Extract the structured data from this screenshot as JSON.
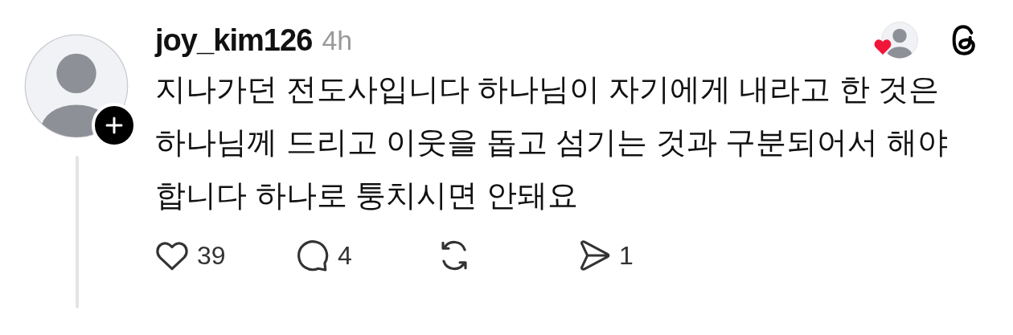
{
  "post": {
    "username": "joy_kim126",
    "time": "4h",
    "body": "지나가던 전도사입니다 하나님이 자기에게 내라고 한 것은 하나님께 드리고 이웃을 돕고 섬기는 것과 구분되어서 해야 합니다 하나로 퉁치시면 안돼요",
    "actions": [
      {
        "kind": "like",
        "count": "39"
      },
      {
        "kind": "reply",
        "count": "4"
      },
      {
        "kind": "repost"
      },
      {
        "kind": "share",
        "count": "1"
      }
    ]
  }
}
